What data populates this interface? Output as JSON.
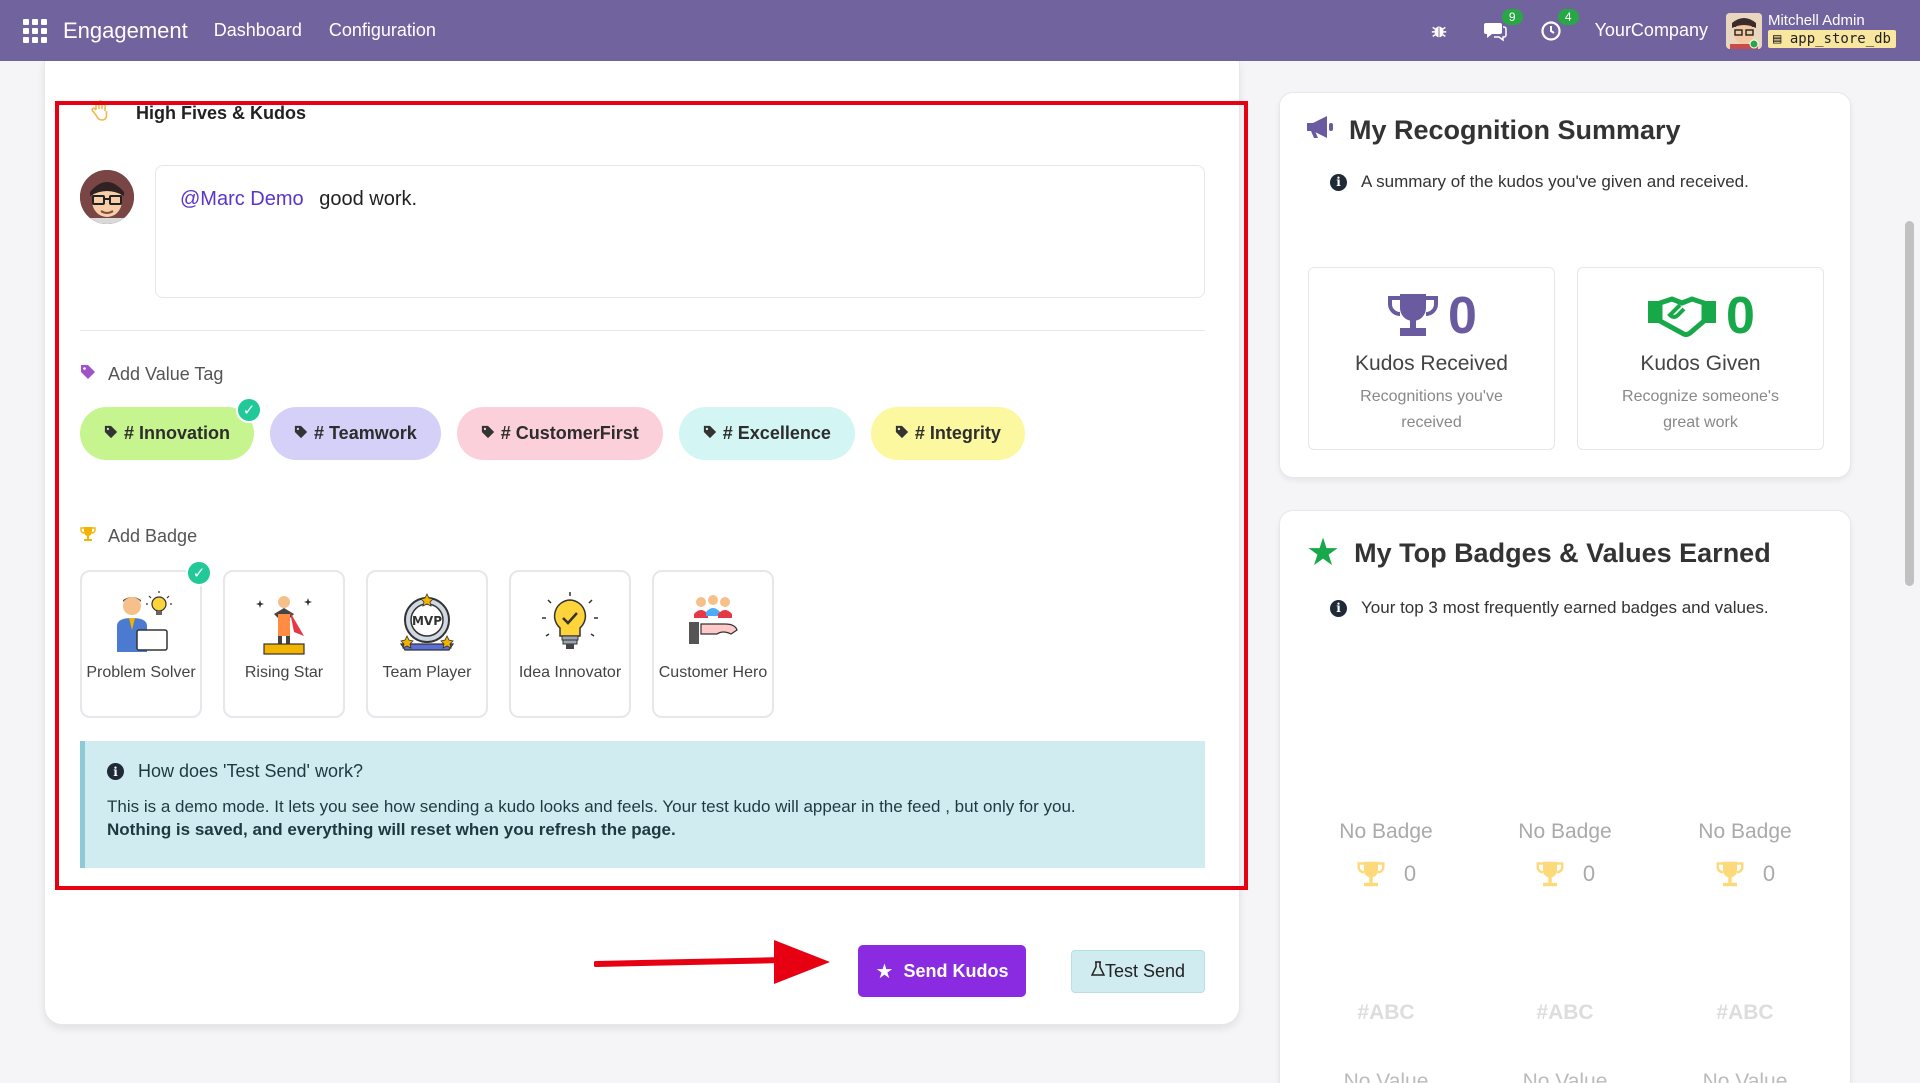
{
  "navbar": {
    "app_name": "Engagement",
    "menu": [
      "Dashboard",
      "Configuration"
    ],
    "messages_count": "9",
    "activities_count": "4",
    "company": "YourCompany",
    "user_name": "Mitchell Admin",
    "db_name": "app_store_db"
  },
  "composer": {
    "section_title": "High Fives & Kudos",
    "mention": "@Marc Demo",
    "message": "good work."
  },
  "value_tags": {
    "label": "Add Value Tag",
    "items": [
      {
        "label": "# Innovation",
        "color": "#c6f48f",
        "selected": true
      },
      {
        "label": "# Teamwork",
        "color": "#d4d0f7",
        "selected": false
      },
      {
        "label": "# CustomerFirst",
        "color": "#fbd0db",
        "selected": false
      },
      {
        "label": "# Excellence",
        "color": "#d3f6f4",
        "selected": false
      },
      {
        "label": "# Integrity",
        "color": "#fbf8a0",
        "selected": false
      }
    ]
  },
  "badges": {
    "label": "Add Badge",
    "items": [
      {
        "name": "Problem Solver",
        "icon": "problem-solver-icon",
        "selected": true
      },
      {
        "name": "Rising Star",
        "icon": "rising-star-icon",
        "selected": false
      },
      {
        "name": "Team Player",
        "icon": "mvp-medal-icon",
        "selected": false
      },
      {
        "name": "Idea Innovator",
        "icon": "lightbulb-icon",
        "selected": false
      },
      {
        "name": "Customer Hero",
        "icon": "customer-hero-icon",
        "selected": false
      }
    ]
  },
  "info": {
    "title": "How does 'Test Send' work?",
    "text": "This is a demo mode. It lets you see how sending a kudo looks and feels. Your test kudo will appear in the feed , but only for you.",
    "bold": "Nothing is saved, and everything will reset when you refresh the page."
  },
  "actions": {
    "send": "Send Kudos",
    "test": "Test Send"
  },
  "summary": {
    "title": "My Recognition Summary",
    "subtitle": "A summary of the kudos you've given and received.",
    "received": {
      "count": "0",
      "label": "Kudos Received",
      "desc": "Recognitions you've received"
    },
    "given": {
      "count": "0",
      "label": "Kudos Given",
      "desc": "Recognize someone's great work"
    }
  },
  "top_badges": {
    "title": "My Top Badges & Values Earned",
    "subtitle": "Your top 3 most frequently earned badges and values.",
    "items": [
      {
        "badge": "No Badge",
        "count": "0",
        "tag": "#ABC",
        "value": "No Value"
      },
      {
        "badge": "No Badge",
        "count": "0",
        "tag": "#ABC",
        "value": "No Value"
      },
      {
        "badge": "No Badge",
        "count": "0",
        "tag": "#ABC",
        "value": "No Value"
      }
    ]
  },
  "colors": {
    "navbar": "#71639e",
    "send_button": "#8a2be2",
    "highlight": "#e60012",
    "trophy_purple": "#6a5aa0",
    "handshake_green": "#17a84a"
  }
}
